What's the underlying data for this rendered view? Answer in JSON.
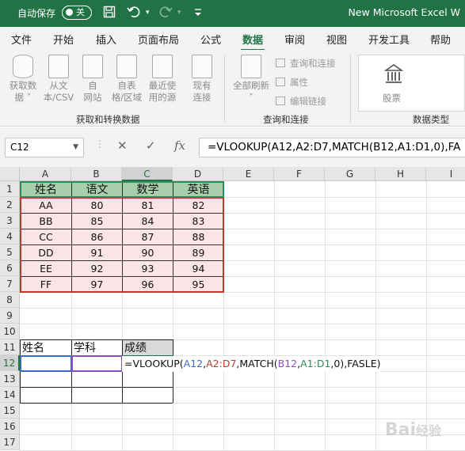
{
  "titlebar": {
    "autosave_label": "自动保存",
    "autosave_state": "关",
    "window_title": "New Microsoft Excel W"
  },
  "tabs": [
    "文件",
    "开始",
    "插入",
    "页面布局",
    "公式",
    "数据",
    "审阅",
    "视图",
    "开发工具",
    "帮助"
  ],
  "active_tab": "数据",
  "ribbon": {
    "get_transform": {
      "buttons": [
        {
          "line1": "获取数",
          "line2": "据 ˅"
        },
        {
          "line1": "从文",
          "line2": "本/CSV"
        },
        {
          "line1": "自",
          "line2": "网站"
        },
        {
          "line1": "自表",
          "line2": "格/区域"
        },
        {
          "line1": "最近使",
          "line2": "用的源"
        },
        {
          "line1": "现有",
          "line2": "连接"
        }
      ],
      "label": "获取和转换数据"
    },
    "queries": {
      "refresh_line1": "全部刷新",
      "refresh_line2": "˅",
      "items": [
        "查询和连接",
        "属性",
        "编辑链接"
      ],
      "label": "查询和连接"
    },
    "data_types": {
      "stock_label": "股票",
      "label": "数据类型"
    }
  },
  "formula_bar": {
    "name_box": "C12",
    "formula": "=VLOOKUP(A12,A2:D7,MATCH(B12,A1:D1,0),FA"
  },
  "sheet": {
    "columns": [
      "A",
      "B",
      "C",
      "D",
      "E",
      "F",
      "G",
      "H",
      "I"
    ],
    "rows": [
      "1",
      "2",
      "3",
      "4",
      "5",
      "6",
      "7",
      "8",
      "9",
      "10",
      "11",
      "12",
      "13",
      "14",
      "15",
      "16",
      "17"
    ],
    "table_headers": [
      "姓名",
      "语文",
      "数学",
      "英语"
    ],
    "table_rows": [
      [
        "AA",
        "80",
        "81",
        "82"
      ],
      [
        "BB",
        "85",
        "84",
        "83"
      ],
      [
        "CC",
        "86",
        "87",
        "88"
      ],
      [
        "DD",
        "91",
        "90",
        "89"
      ],
      [
        "EE",
        "92",
        "93",
        "94"
      ],
      [
        "FF",
        "97",
        "96",
        "95"
      ]
    ],
    "lookup_headers": [
      "姓名",
      "学科",
      "成绩"
    ],
    "formula_parts": [
      {
        "t": "=VLOOKUP(",
        "c": "#111111"
      },
      {
        "t": "A12",
        "c": "#3a6bc4"
      },
      {
        "t": ",",
        "c": "#111111"
      },
      {
        "t": "A2:D7",
        "c": "#c0392b"
      },
      {
        "t": ",MATCH(",
        "c": "#111111"
      },
      {
        "t": "B12",
        "c": "#8a4fbf"
      },
      {
        "t": ",",
        "c": "#111111"
      },
      {
        "t": "A1:D1",
        "c": "#2e8b57"
      },
      {
        "t": ",0),FASLE)",
        "c": "#111111"
      }
    ]
  },
  "colors": {
    "excel_green": "#217346",
    "header_fill": "#a8cfac",
    "row_fill": "#fbe4e6",
    "ref_blue": "#3a6bc4",
    "ref_purple": "#8a4fbf",
    "ref_red": "#c0392b"
  }
}
